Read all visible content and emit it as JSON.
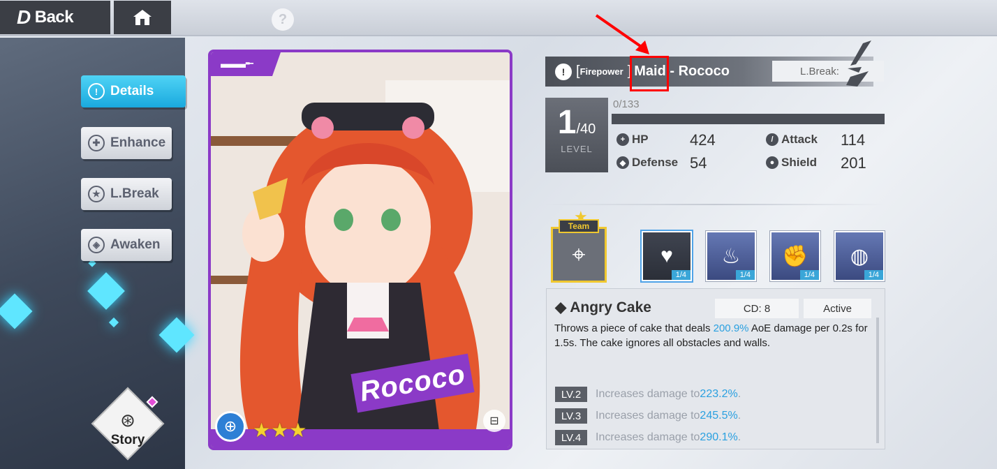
{
  "topbar": {
    "back_label": "Back",
    "back_glyph": "D",
    "home_icon": "home-icon",
    "help_glyph": "?"
  },
  "sidebar": {
    "items": [
      {
        "label": "Details",
        "icon": "exclamation-icon",
        "active": true
      },
      {
        "label": "Enhance",
        "icon": "enhance-icon",
        "active": false
      },
      {
        "label": "L.Break",
        "icon": "star-icon",
        "active": false
      },
      {
        "label": "Awaken",
        "icon": "awaken-icon",
        "active": false
      }
    ],
    "story_label": "Story"
  },
  "card": {
    "name_stamp": "Rococo",
    "stars": "★★★",
    "border_color": "#8b3ac7"
  },
  "character": {
    "type": "Firepower",
    "bracket_open": "[",
    "bracket_close": "]",
    "name": "Maid - Rococo",
    "lbreak_label": "L.Break:"
  },
  "level": {
    "current": "1",
    "max": "/40",
    "label": "LEVEL",
    "exp": "0/133"
  },
  "stats": [
    {
      "label": "HP",
      "value": "424",
      "icon": "hp-icon"
    },
    {
      "label": "Attack",
      "value": "114",
      "icon": "attack-icon"
    },
    {
      "label": "Defense",
      "value": "54",
      "icon": "defense-icon"
    },
    {
      "label": "Shield",
      "value": "201",
      "icon": "shield-icon"
    }
  ],
  "team": {
    "label": "Team"
  },
  "skills": [
    {
      "name": "cake-skill",
      "level": "1/4",
      "selected": true
    },
    {
      "name": "fire-skill",
      "level": "1/4",
      "selected": false
    },
    {
      "name": "fist-skill",
      "level": "1/4",
      "selected": false
    },
    {
      "name": "drop-skill",
      "level": "1/4",
      "selected": false
    }
  ],
  "skill_detail": {
    "name": "Angry Cake",
    "cd": "CD: 8",
    "kind": "Active",
    "desc_pre": "Throws a piece of cake that deals ",
    "desc_hl": "200.9%",
    "desc_post": " AoE damage per 0.2s for 1.5s. The cake ignores all obstacles and walls.",
    "levels": [
      {
        "tag": "LV.2",
        "text": "Increases damage to ",
        "value": "223.2%",
        "end": "."
      },
      {
        "tag": "LV.3",
        "text": "Increases damage to ",
        "value": "245.5%",
        "end": "."
      },
      {
        "tag": "LV.4",
        "text": "Increases damage to ",
        "value": "290.1%",
        "end": "."
      }
    ]
  },
  "colors": {
    "accent_blue": "#2aa0e0",
    "card_purple": "#8b3ac7",
    "highlight_red": "#ff0000",
    "team_gold": "#f0c830"
  }
}
